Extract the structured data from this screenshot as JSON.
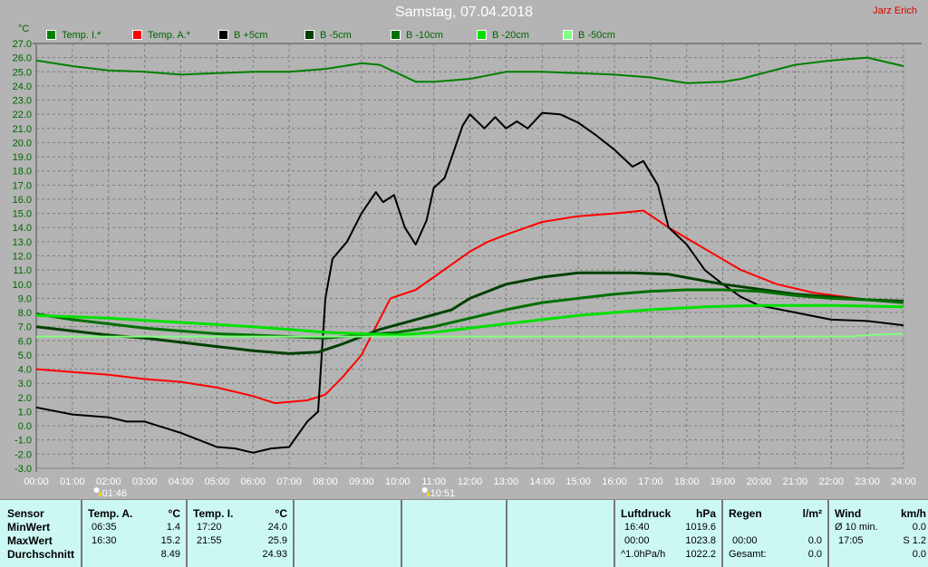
{
  "title": "Samstag, 07.04.2018",
  "author": "Jarz Erich",
  "unit": "°C",
  "colors": {
    "bg": "#b4b4b4",
    "grid": "#7a7a7a",
    "axis_text": "#006400",
    "table_bg": "#ccf8f4"
  },
  "chart_data": {
    "type": "line",
    "title": "Samstag, 07.04.2018",
    "ylabel": "°C",
    "ylim": [
      -3,
      27
    ],
    "xlim": [
      0,
      24
    ],
    "grid": true,
    "legend": "top",
    "yticks": [
      "27.0",
      "26.0",
      "25.0",
      "24.0",
      "23.0",
      "22.0",
      "21.0",
      "20.0",
      "19.0",
      "18.0",
      "17.0",
      "16.0",
      "15.0",
      "14.0",
      "13.0",
      "12.0",
      "11.0",
      "10.0",
      "9.0",
      "8.0",
      "7.0",
      "6.0",
      "5.0",
      "4.0",
      "3.0",
      "2.0",
      "1.0",
      "0.0",
      "-1.0",
      "-2.0",
      "-3.0"
    ],
    "xticks": [
      "00:00",
      "01:00",
      "02:00",
      "03:00",
      "04:00",
      "05:00",
      "06:00",
      "07:00",
      "08:00",
      "09:00",
      "10:00",
      "11:00",
      "12:00",
      "13:00",
      "14:00",
      "15:00",
      "16:00",
      "17:00",
      "18:00",
      "19:00",
      "20:00",
      "21:00",
      "22:00",
      "23:00",
      "24:00"
    ],
    "markers": [
      {
        "label": "01:46",
        "hour": 1.77,
        "kind": "sunrise"
      },
      {
        "label": "10:51",
        "hour": 10.85,
        "kind": "moon"
      }
    ],
    "series": [
      {
        "name": "Temp. I.*",
        "color": "#008000",
        "width": 2,
        "points": [
          [
            0,
            25.8
          ],
          [
            1,
            25.4
          ],
          [
            2,
            25.1
          ],
          [
            3,
            25.0
          ],
          [
            4,
            24.8
          ],
          [
            5,
            24.9
          ],
          [
            6,
            25.0
          ],
          [
            7,
            25.0
          ],
          [
            8,
            25.2
          ],
          [
            9,
            25.6
          ],
          [
            9.5,
            25.5
          ],
          [
            10.5,
            24.3
          ],
          [
            11,
            24.3
          ],
          [
            12,
            24.5
          ],
          [
            13,
            25.0
          ],
          [
            14,
            25.0
          ],
          [
            15,
            24.9
          ],
          [
            16,
            24.8
          ],
          [
            17,
            24.6
          ],
          [
            18,
            24.2
          ],
          [
            19,
            24.3
          ],
          [
            19.5,
            24.5
          ],
          [
            21,
            25.5
          ],
          [
            22,
            25.8
          ],
          [
            23,
            26.0
          ],
          [
            24,
            25.4
          ]
        ]
      },
      {
        "name": "Temp. A.*",
        "color": "#ff0000",
        "width": 2,
        "points": [
          [
            0,
            4.0
          ],
          [
            1,
            3.8
          ],
          [
            2,
            3.6
          ],
          [
            3,
            3.3
          ],
          [
            4,
            3.1
          ],
          [
            5,
            2.7
          ],
          [
            6,
            2.1
          ],
          [
            6.6,
            1.6
          ],
          [
            7.5,
            1.8
          ],
          [
            8,
            2.2
          ],
          [
            8.5,
            3.5
          ],
          [
            9,
            5.0
          ],
          [
            9.3,
            6.5
          ],
          [
            9.8,
            9.0
          ],
          [
            10.5,
            9.6
          ],
          [
            11,
            10.5
          ],
          [
            12,
            12.3
          ],
          [
            12.5,
            13.0
          ],
          [
            13,
            13.5
          ],
          [
            14,
            14.4
          ],
          [
            15,
            14.8
          ],
          [
            16,
            15.0
          ],
          [
            16.8,
            15.2
          ],
          [
            17.5,
            14.0
          ],
          [
            18.5,
            12.5
          ],
          [
            19.5,
            11.0
          ],
          [
            20.5,
            10.0
          ],
          [
            21.5,
            9.4
          ],
          [
            23,
            8.9
          ],
          [
            24,
            8.7
          ]
        ]
      },
      {
        "name": "B +5cm",
        "color": "#000000",
        "width": 2,
        "points": [
          [
            0,
            1.3
          ],
          [
            1,
            0.8
          ],
          [
            2,
            0.6
          ],
          [
            2.5,
            0.3
          ],
          [
            3,
            0.3
          ],
          [
            4,
            -0.5
          ],
          [
            5,
            -1.5
          ],
          [
            5.5,
            -1.6
          ],
          [
            6,
            -1.9
          ],
          [
            6.5,
            -1.6
          ],
          [
            7,
            -1.5
          ],
          [
            7.5,
            0.3
          ],
          [
            7.8,
            1.0
          ],
          [
            8,
            9.0
          ],
          [
            8.2,
            11.8
          ],
          [
            8.6,
            13.0
          ],
          [
            9,
            15.0
          ],
          [
            9.4,
            16.5
          ],
          [
            9.6,
            15.8
          ],
          [
            9.9,
            16.3
          ],
          [
            10.2,
            14.0
          ],
          [
            10.5,
            12.8
          ],
          [
            10.8,
            14.5
          ],
          [
            11,
            16.8
          ],
          [
            11.3,
            17.5
          ],
          [
            11.8,
            21.2
          ],
          [
            12,
            22.0
          ],
          [
            12.4,
            21.0
          ],
          [
            12.7,
            21.8
          ],
          [
            13,
            21.0
          ],
          [
            13.3,
            21.5
          ],
          [
            13.6,
            21.0
          ],
          [
            14,
            22.1
          ],
          [
            14.5,
            22.0
          ],
          [
            15,
            21.4
          ],
          [
            15.5,
            20.5
          ],
          [
            16,
            19.5
          ],
          [
            16.5,
            18.3
          ],
          [
            16.8,
            18.7
          ],
          [
            17.2,
            17.0
          ],
          [
            17.5,
            14.0
          ],
          [
            18,
            12.8
          ],
          [
            18.5,
            11.0
          ],
          [
            19,
            10.0
          ],
          [
            19.5,
            9.1
          ],
          [
            20,
            8.5
          ],
          [
            21,
            8.0
          ],
          [
            22,
            7.5
          ],
          [
            23,
            7.4
          ],
          [
            24,
            7.1
          ]
        ]
      },
      {
        "name": "B -5cm",
        "color": "#004000",
        "width": 3,
        "points": [
          [
            0,
            7.0
          ],
          [
            1,
            6.7
          ],
          [
            2,
            6.4
          ],
          [
            3,
            6.2
          ],
          [
            4,
            5.9
          ],
          [
            5,
            5.6
          ],
          [
            6,
            5.3
          ],
          [
            7,
            5.1
          ],
          [
            7.8,
            5.2
          ],
          [
            8.5,
            5.8
          ],
          [
            9.5,
            6.8
          ],
          [
            10.5,
            7.5
          ],
          [
            11.5,
            8.2
          ],
          [
            12,
            9.0
          ],
          [
            13,
            10.0
          ],
          [
            14,
            10.5
          ],
          [
            15,
            10.8
          ],
          [
            16.5,
            10.8
          ],
          [
            17.5,
            10.7
          ],
          [
            19,
            10.0
          ],
          [
            21,
            9.3
          ],
          [
            23,
            8.9
          ],
          [
            24,
            8.8
          ]
        ]
      },
      {
        "name": "B -10cm",
        "color": "#007000",
        "width": 3,
        "points": [
          [
            0,
            7.9
          ],
          [
            1,
            7.5
          ],
          [
            2,
            7.2
          ],
          [
            3,
            6.9
          ],
          [
            4,
            6.7
          ],
          [
            5,
            6.5
          ],
          [
            6,
            6.4
          ],
          [
            7,
            6.3
          ],
          [
            8,
            6.2
          ],
          [
            9,
            6.4
          ],
          [
            10,
            6.6
          ],
          [
            11,
            7.0
          ],
          [
            12,
            7.6
          ],
          [
            13,
            8.2
          ],
          [
            14,
            8.7
          ],
          [
            15,
            9.0
          ],
          [
            16,
            9.3
          ],
          [
            17,
            9.5
          ],
          [
            18,
            9.6
          ],
          [
            19,
            9.6
          ],
          [
            20,
            9.5
          ],
          [
            21,
            9.2
          ],
          [
            22,
            9.0
          ],
          [
            23,
            8.9
          ],
          [
            24,
            8.7
          ]
        ]
      },
      {
        "name": "B -20cm",
        "color": "#00e000",
        "width": 3,
        "points": [
          [
            0,
            7.8
          ],
          [
            2,
            7.6
          ],
          [
            4,
            7.3
          ],
          [
            6,
            7.0
          ],
          [
            7,
            6.8
          ],
          [
            8,
            6.6
          ],
          [
            10,
            6.4
          ],
          [
            11,
            6.6
          ],
          [
            12,
            6.9
          ],
          [
            13,
            7.2
          ],
          [
            14,
            7.5
          ],
          [
            15,
            7.8
          ],
          [
            16,
            8.0
          ],
          [
            17,
            8.2
          ],
          [
            18.5,
            8.4
          ],
          [
            20,
            8.5
          ],
          [
            22,
            8.5
          ],
          [
            24,
            8.4
          ]
        ]
      },
      {
        "name": "B -50cm",
        "color": "#80ff80",
        "width": 2,
        "points": [
          [
            0,
            6.3
          ],
          [
            10,
            6.3
          ],
          [
            20,
            6.3
          ],
          [
            22.5,
            6.3
          ],
          [
            23,
            6.4
          ],
          [
            24,
            6.5
          ]
        ]
      }
    ]
  },
  "table": {
    "sensor": {
      "header": "Sensor",
      "rows": [
        "MinWert",
        "MaxWert",
        "Durchschnitt"
      ]
    },
    "temp_a": {
      "header": "Temp. A.",
      "unit": "°C",
      "min_time": "06:35",
      "min": "1.4",
      "max_time": "16:30",
      "max": "15.2",
      "avg": "8.49"
    },
    "temp_i": {
      "header": "Temp. I.",
      "unit": "°C",
      "min_time": "17:20",
      "min": "24.0",
      "max_time": "21:55",
      "max": "25.9",
      "avg": "24.93"
    },
    "pressure": {
      "header": "Luftdruck",
      "unit": "hPa",
      "min_time": "16:40",
      "min": "1019.6",
      "max_time": "00:00",
      "max": "1023.8",
      "trend": "^1.0hPa/h",
      "current": "1022.2"
    },
    "rain": {
      "header": "Regen",
      "unit": "l/m²",
      "time": "00:00",
      "value": "0.0",
      "total_label": "Gesamt:",
      "total": "0.0"
    },
    "wind": {
      "header": "Wind",
      "unit": "km/h",
      "avg_label": "Ø 10 min.",
      "avg": "0.0",
      "max_time": "17:05",
      "max": "S 1.2",
      "current": "0.0"
    }
  }
}
